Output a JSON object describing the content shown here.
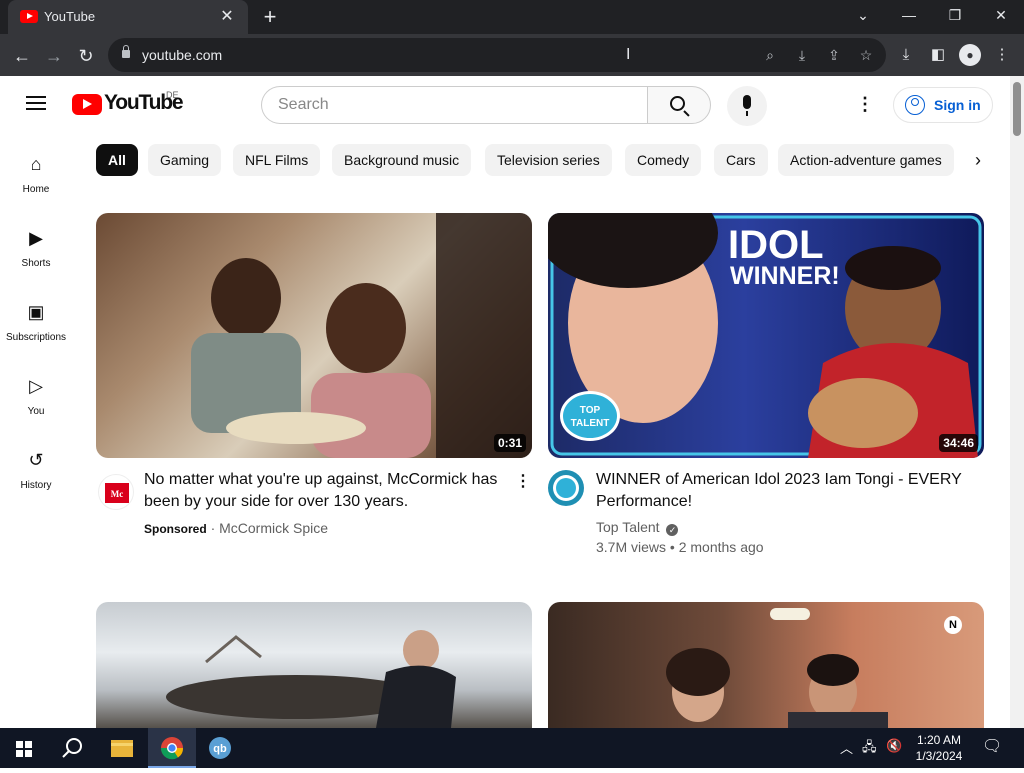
{
  "browser": {
    "tab_title": "YouTube",
    "tab_close": "✕",
    "new_tab": "+",
    "url": "youtube.com",
    "window_controls": [
      "⌄",
      "—",
      "❐",
      "✕"
    ]
  },
  "masthead": {
    "wordmark": "YouTube",
    "region": "DE",
    "search_placeholder": "Search",
    "signin_label": "Sign in"
  },
  "sidebar": {
    "items": [
      {
        "label": "Home",
        "icon": "⌂"
      },
      {
        "label": "Shorts",
        "icon": "▶"
      },
      {
        "label": "Subscriptions",
        "icon": "▣"
      },
      {
        "label": "You",
        "icon": "▷"
      },
      {
        "label": "History",
        "icon": "↺"
      }
    ]
  },
  "chips": [
    "All",
    "Gaming",
    "NFL Films",
    "Background music",
    "Television series",
    "Comedy",
    "Cars",
    "Action-adventure games"
  ],
  "videos": [
    {
      "title": "No matter what you're up against, McCormick has been by your side for over 130 years.",
      "duration": "0:31",
      "sponsored": "Sponsored",
      "channel": "McCormick Spice",
      "channel_separator": "·"
    },
    {
      "title": "WINNER of American Idol 2023 Iam Tongi - EVERY Performance!",
      "duration": "34:46",
      "channel": "Top Talent",
      "views": "3.7M views",
      "age": "2 months ago",
      "separator": "•",
      "thumb_overlay_line1": "IDOL",
      "thumb_overlay_line2": "WINNER!",
      "thumb_badge_line1": "TOP",
      "thumb_badge_line2": "TALENT"
    }
  ],
  "taskbar": {
    "time": "1:20 AM",
    "date": "1/3/2024"
  },
  "colors": {
    "youtube_red": "#ff0000",
    "link_blue": "#065fd4",
    "browser_dark": "#35363a",
    "taskbar": "#101624"
  }
}
